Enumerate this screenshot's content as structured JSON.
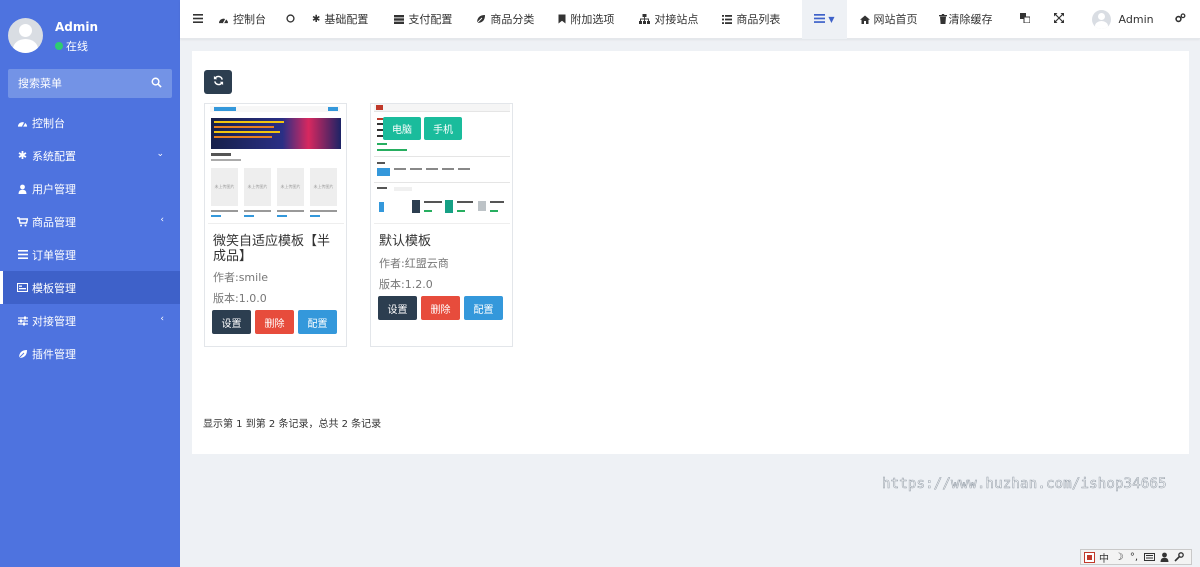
{
  "sidebar": {
    "user": {
      "name": "Admin",
      "status": "在线"
    },
    "search": {
      "placeholder": "搜索菜单"
    },
    "items": [
      {
        "label": "控制台",
        "icon": "dashboard-icon"
      },
      {
        "label": "系统配置",
        "icon": "gear-icon",
        "caret": "chevron-down-icon"
      },
      {
        "label": "用户管理",
        "icon": "user-icon"
      },
      {
        "label": "商品管理",
        "icon": "cart-icon",
        "caret": "chevron-left-icon"
      },
      {
        "label": "订单管理",
        "icon": "list-icon"
      },
      {
        "label": "模板管理",
        "icon": "template-icon",
        "active": true
      },
      {
        "label": "对接管理",
        "icon": "sliders-icon",
        "caret": "chevron-left-icon"
      },
      {
        "label": "插件管理",
        "icon": "leaf-icon"
      }
    ]
  },
  "navbar": {
    "items": [
      {
        "label": "控制台",
        "icon": "dashboard-icon"
      },
      {
        "label": "基础配置",
        "icon": "gear-icon"
      },
      {
        "label": "支付配置",
        "icon": "server-icon"
      },
      {
        "label": "商品分类",
        "icon": "leaf-icon"
      },
      {
        "label": "附加选项",
        "icon": "bookmark-icon"
      },
      {
        "label": "对接站点",
        "icon": "sitemap-icon"
      },
      {
        "label": "商品列表",
        "icon": "list-icon"
      }
    ],
    "home_label": "网站首页",
    "clear_cache_label": "清除缓存",
    "user_name": "Admin"
  },
  "templates": [
    {
      "title": "微笑自适应模板【半成品】",
      "author": "作者:smile",
      "version": "版本:1.0.0",
      "buttons": [
        "设置",
        "删除",
        "配置"
      ]
    },
    {
      "title": "默认模板",
      "author": "作者:红盟云商",
      "version": "版本:1.2.0",
      "buttons": [
        "设置",
        "删除",
        "配置"
      ],
      "overlay": [
        "电脑",
        "手机"
      ]
    }
  ],
  "thumb1": {
    "box_label": "未上传图片"
  },
  "pager_info": "显示第 1 到第 2 条记录，总共 2 条记录",
  "watermark": "https://www.huzhan.com/ishop34665",
  "ime": {
    "mode": "中"
  },
  "colors": {
    "sidebar": "#4e73df",
    "accent_dark": "#2c3e50",
    "danger": "#e74c3c",
    "primary": "#3498db",
    "success": "#1abc9c"
  }
}
